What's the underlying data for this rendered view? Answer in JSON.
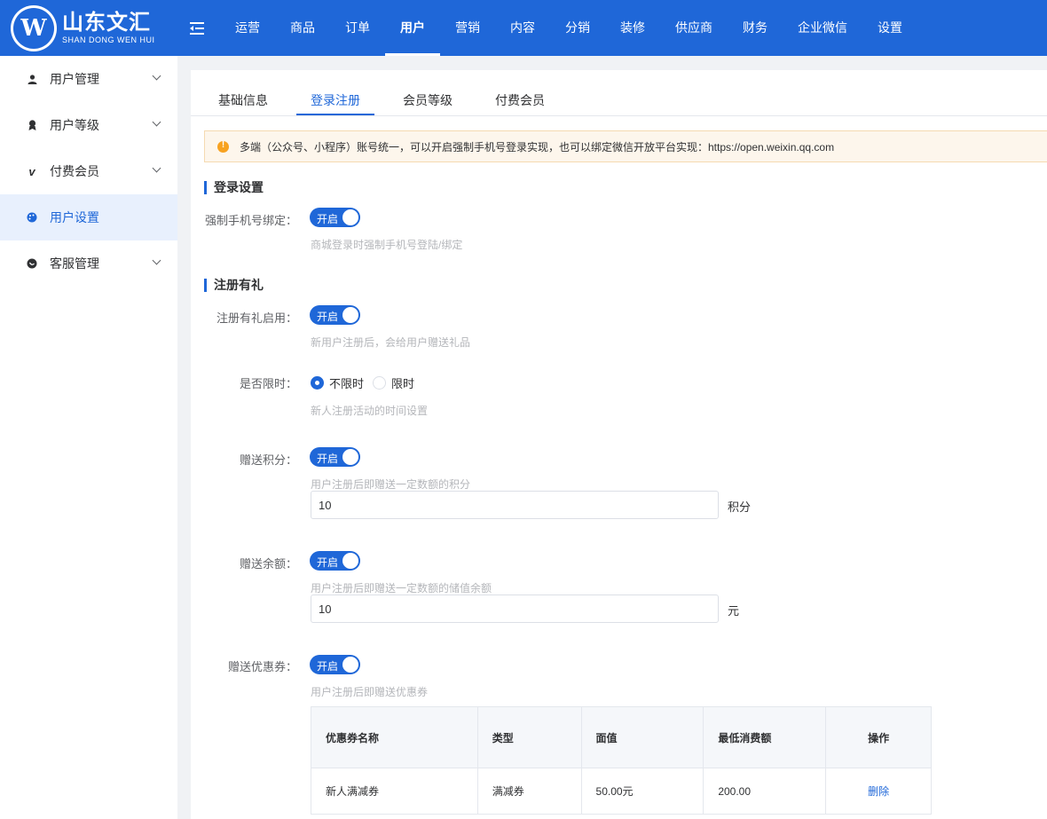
{
  "brand": {
    "name_cn": "山东文汇",
    "name_en": "SHAN DONG WEN HUI",
    "mark": "W",
    "primary_color": "#1f67d8"
  },
  "topnav": {
    "items": [
      "运营",
      "商品",
      "订单",
      "用户",
      "营销",
      "内容",
      "分销",
      "装修",
      "供应商",
      "财务",
      "企业微信",
      "设置"
    ],
    "active": "用户"
  },
  "sidebar": {
    "items": [
      {
        "label": "用户管理",
        "icon": "user-icon",
        "expandable": true
      },
      {
        "label": "用户等级",
        "icon": "level-icon",
        "expandable": true
      },
      {
        "label": "付费会员",
        "icon": "vip-icon",
        "expandable": true
      },
      {
        "label": "用户设置",
        "icon": "palette-icon",
        "expandable": false,
        "active": true
      },
      {
        "label": "客服管理",
        "icon": "chat-icon",
        "expandable": true
      }
    ]
  },
  "tabs": {
    "items": [
      "基础信息",
      "登录注册",
      "会员等级",
      "付费会员"
    ],
    "active": "登录注册"
  },
  "notice": {
    "text": "多端（公众号、小程序）账号统一，可以开启强制手机号登录实现，也可以绑定微信开放平台实现：https://open.weixin.qq.com"
  },
  "login_section": {
    "title": "登录设置",
    "force_phone": {
      "label": "强制手机号绑定：",
      "switch_text": "开启",
      "enabled": true,
      "hint": "商城登录时强制手机号登陆/绑定"
    }
  },
  "register_section": {
    "title": "注册有礼",
    "enable": {
      "label": "注册有礼启用：",
      "switch_text": "开启",
      "enabled": true,
      "hint": "新用户注册后，会给用户赠送礼品"
    },
    "time_limit": {
      "label": "是否限时：",
      "options": [
        "不限时",
        "限时"
      ],
      "selected": "不限时",
      "hint": "新人注册活动的时间设置"
    },
    "points": {
      "label": "赠送积分：",
      "switch_text": "开启",
      "enabled": true,
      "hint": "用户注册后即赠送一定数额的积分",
      "value": "10",
      "unit": "积分"
    },
    "balance": {
      "label": "赠送余额：",
      "switch_text": "开启",
      "enabled": true,
      "hint": "用户注册后即赠送一定数额的储值余额",
      "value": "10",
      "unit": "元"
    },
    "coupon": {
      "label": "赠送优惠券：",
      "switch_text": "开启",
      "enabled": true,
      "hint": "用户注册后即赠送优惠券"
    }
  },
  "coupon_table": {
    "headers": [
      "优惠券名称",
      "类型",
      "面值",
      "最低消费额",
      "操作"
    ],
    "rows": [
      {
        "name": "新人满减券",
        "type": "满减券",
        "value": "50.00元",
        "min": "200.00",
        "action": "删除"
      }
    ]
  }
}
